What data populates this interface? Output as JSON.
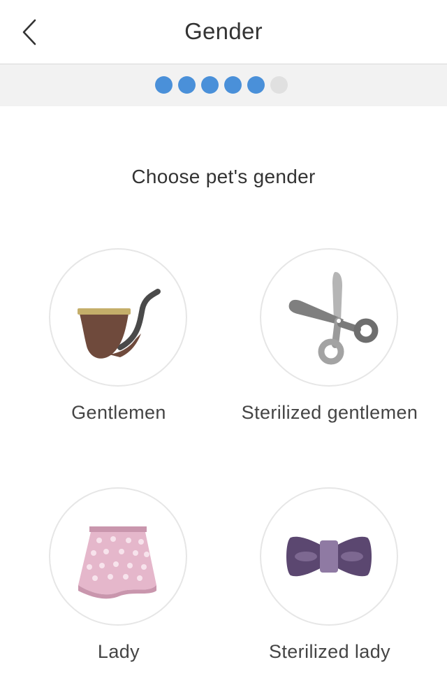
{
  "header": {
    "title": "Gender",
    "back_icon": "chevron-left-icon"
  },
  "progress": {
    "total_steps": 6,
    "completed_steps": 5,
    "active_color": "#4a90d9",
    "inactive_color": "#e0e0e0"
  },
  "prompt": "Choose pet's gender",
  "options": [
    {
      "label": "Gentlemen",
      "icon": "pipe-icon"
    },
    {
      "label": "Sterilized gentlemen",
      "icon": "scissors-icon"
    },
    {
      "label": "Lady",
      "icon": "skirt-icon"
    },
    {
      "label": "Sterilized lady",
      "icon": "bow-tie-icon"
    }
  ]
}
